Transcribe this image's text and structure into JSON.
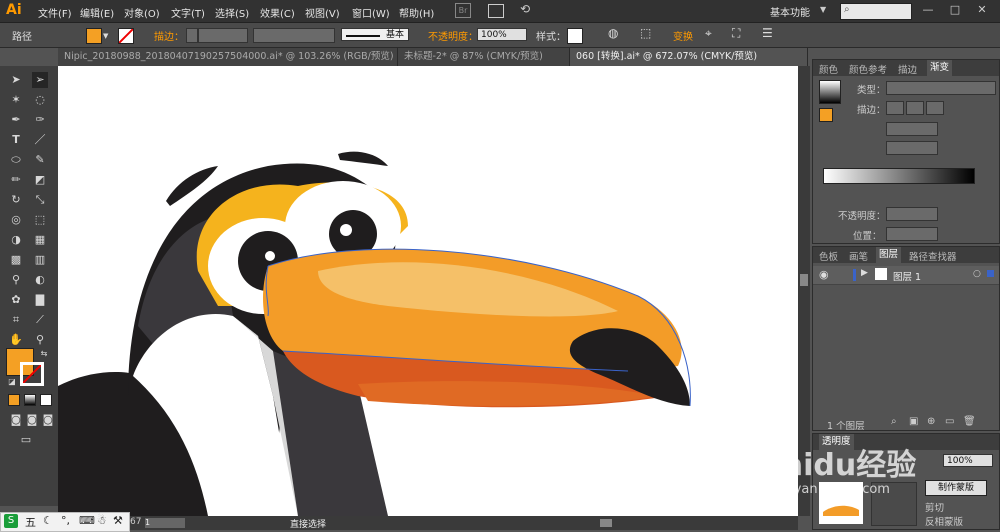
{
  "app": {
    "logo": "Ai"
  },
  "menu": [
    "文件(F)",
    "编辑(E)",
    "对象(O)",
    "文字(T)",
    "选择(S)",
    "效果(C)",
    "视图(V)",
    "窗口(W)",
    "帮助(H)"
  ],
  "bridge_label": "Br",
  "workspace": "基本功能",
  "control": {
    "selection_type": "路径",
    "stroke_label": "描边：",
    "stroke_style": "基本",
    "opacity_label": "不透明度：",
    "opacity_value": "100%",
    "style_label": "样式：",
    "transform_label": "变换",
    "fill_color": "#f4a024",
    "accent": "#ff9a00"
  },
  "tabs": [
    {
      "label": "Nipic_20180988_20180407190257504000.ai* @ 103.26% (RGB/预览)"
    },
    {
      "label": "未标题-2* @ 87% (CMYK/预览)"
    },
    {
      "label": "060 [转换].ai* @ 672.07% (CMYK/预览)"
    }
  ],
  "gradient_panel": {
    "tabs": [
      "颜色",
      "颜色参考",
      "描边",
      "渐变"
    ],
    "type_label": "类型：",
    "stroke_label": "描边：",
    "opacity_label": "不透明度：",
    "position_label": "位置："
  },
  "layers_panel": {
    "tabs": [
      "色板",
      "画笔",
      "图层",
      "路径查找器"
    ],
    "layer_name": "图层 1",
    "count_label": "1 个图层"
  },
  "transparency_panel": {
    "tab": "透明度",
    "opacity_value": "100%",
    "make_mask": "制作蒙版",
    "clip": "剪切",
    "invert": "反相蒙版"
  },
  "status": {
    "zoom": "67",
    "page": "1",
    "tool_name": "直接选择"
  },
  "ime": {
    "label": "五"
  },
  "watermark": {
    "text": "Baidu经验",
    "sub": "jingyan.baidu.com"
  }
}
